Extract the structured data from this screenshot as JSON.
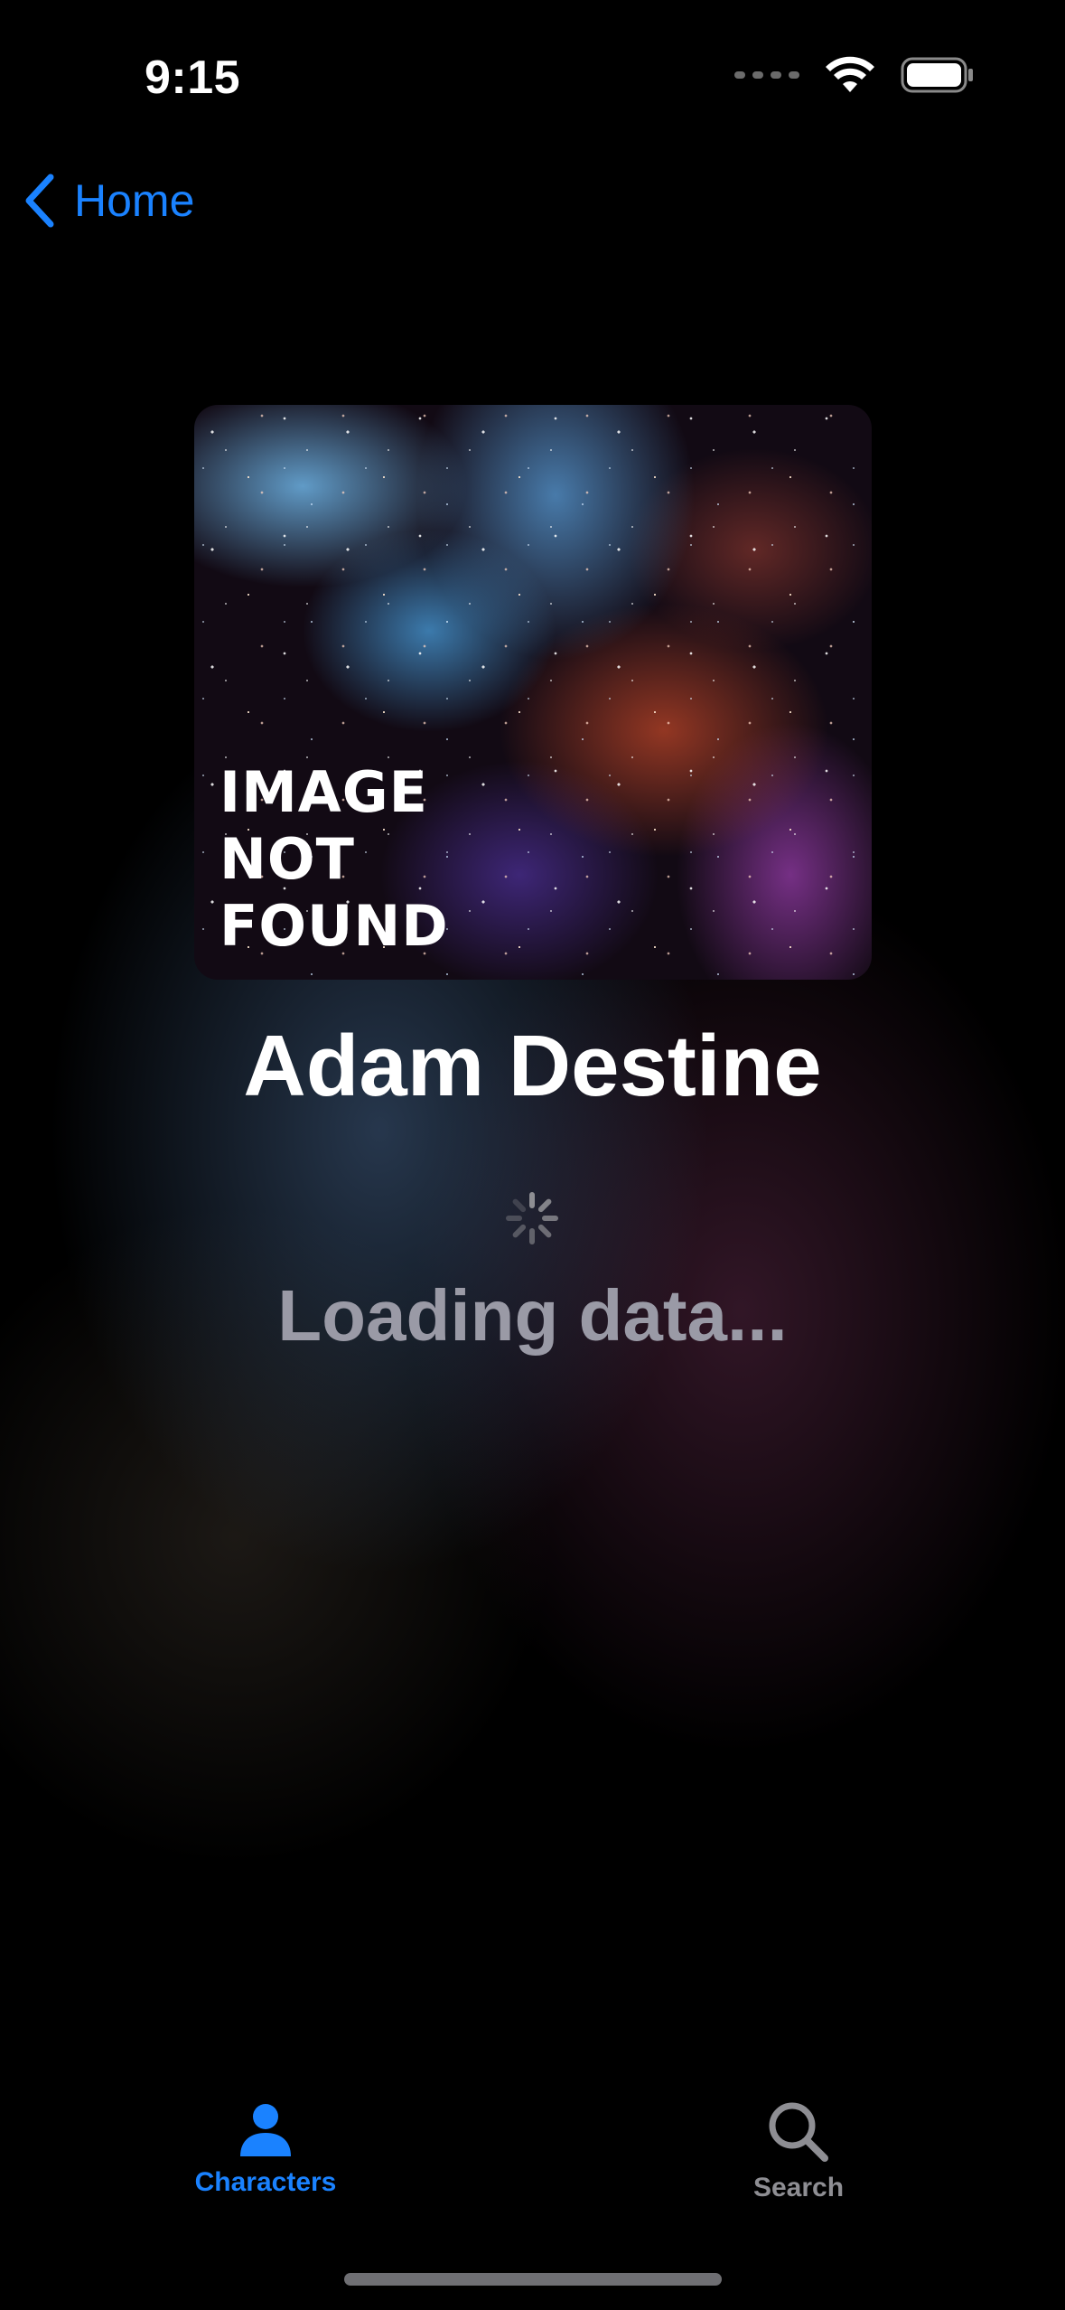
{
  "status_bar": {
    "time": "9:15"
  },
  "nav": {
    "back_label": "Home"
  },
  "hero": {
    "caption": "IMAGE\nNOT\nFOUND"
  },
  "character": {
    "name": "Adam Destine"
  },
  "loading": {
    "text": "Loading data..."
  },
  "tab_bar": {
    "tabs": [
      {
        "label": "Characters",
        "icon": "person-icon",
        "selected": true
      },
      {
        "label": "Search",
        "icon": "search-icon",
        "selected": false
      }
    ]
  },
  "colors": {
    "accent": "#1a82ff",
    "inactive": "#8e8e93",
    "loading_text": "#9a9aa6",
    "background": "#000000"
  }
}
